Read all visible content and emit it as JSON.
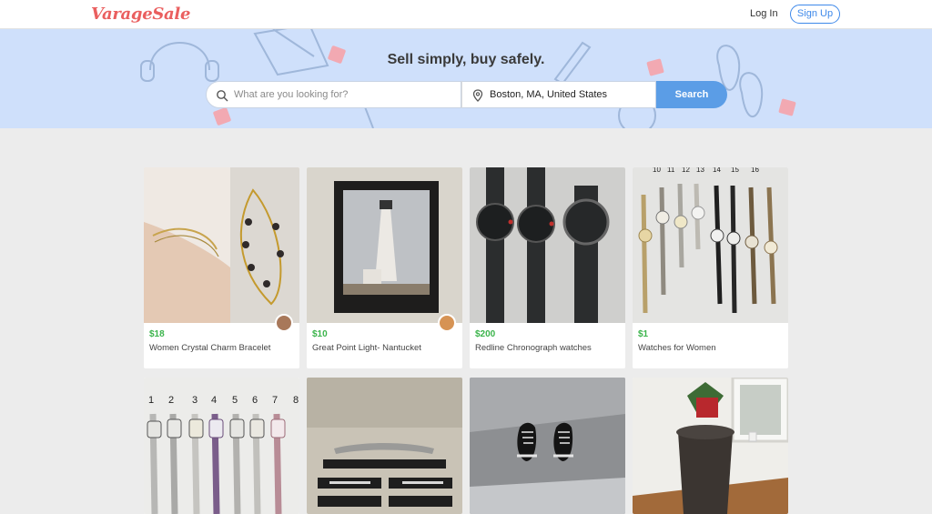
{
  "app": {
    "logo": "VarageSale",
    "login_label": "Log In",
    "signup_label": "Sign Up"
  },
  "hero": {
    "tagline": "Sell simply, buy safely.",
    "search_placeholder": "What are you looking for?",
    "location_value": "Boston, MA, United States",
    "search_button": "Search"
  },
  "listings": [
    {
      "price": "$18",
      "title": "Women Crystal Charm Bracelet",
      "photo": "bracelets",
      "has_avatar": true
    },
    {
      "price": "$10",
      "title": "Great Point Light- Nantucket",
      "photo": "lighthouse",
      "has_avatar": true
    },
    {
      "price": "$200",
      "title": "Redline Chronograph watches",
      "photo": "chronographs",
      "has_avatar": false
    },
    {
      "price": "$1",
      "title": "Watches for Women",
      "photo": "watches-women",
      "has_avatar": false
    },
    {
      "price": "",
      "title": "",
      "photo": "numbered-watches",
      "has_avatar": false
    },
    {
      "price": "",
      "title": "",
      "photo": "car-trim",
      "has_avatar": false
    },
    {
      "price": "",
      "title": "",
      "photo": "sneakers",
      "has_avatar": false
    },
    {
      "price": "",
      "title": "",
      "photo": "side-table",
      "has_avatar": false
    }
  ],
  "photo_labels": {
    "watch_numbers_top": [
      "10",
      "11",
      "12",
      "13",
      "14",
      "15",
      "16"
    ],
    "watch_numbers_bottom": [
      "1",
      "2",
      "3",
      "4",
      "5",
      "6",
      "7",
      "8"
    ]
  },
  "colors": {
    "brand": "#ea5f5f",
    "accent": "#3e89ea",
    "price": "#3bb44b",
    "hero_bg": "#cfe0fb"
  }
}
